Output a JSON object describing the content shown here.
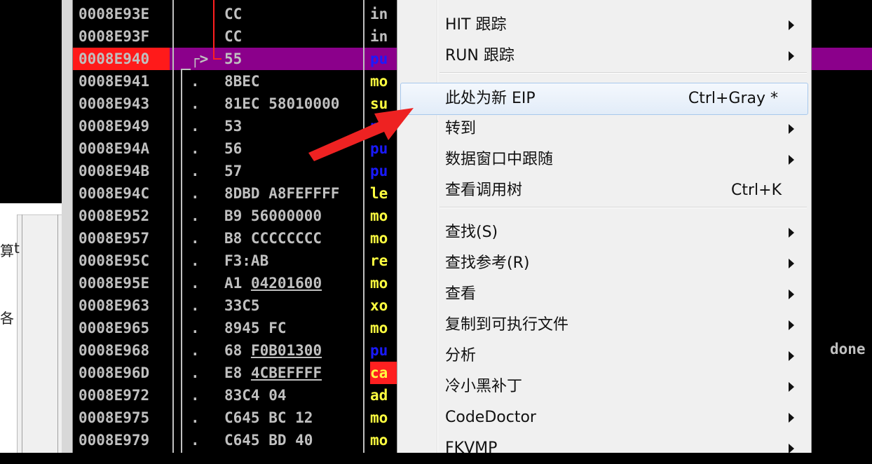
{
  "left_window": {
    "glyph_1": "算",
    "glyph_1b": "t",
    "glyph_2": "各"
  },
  "disassembly": {
    "rows": [
      {
        "addr": "0008E93E",
        "mark": "",
        "hex": "CC",
        "mn": "in",
        "mn_color": "gray"
      },
      {
        "addr": "0008E93F",
        "mark": "",
        "hex": "CC",
        "mn": "in",
        "mn_color": "gray"
      },
      {
        "addr": "0008E940",
        "mark": "┌>",
        "hex": "55",
        "mn": "pu",
        "mn_color": "blue",
        "eip": true
      },
      {
        "addr": "0008E941",
        "mark": ".",
        "hex": "8BEC",
        "mn": "mo",
        "mn_color": "yellow"
      },
      {
        "addr": "0008E943",
        "mark": ".",
        "hex": "81EC 58010000",
        "mn": "su",
        "mn_color": "yellow"
      },
      {
        "addr": "0008E949",
        "mark": ".",
        "hex": "53",
        "mn": "pu",
        "mn_color": "blue"
      },
      {
        "addr": "0008E94A",
        "mark": ".",
        "hex": "56",
        "mn": "pu",
        "mn_color": "blue"
      },
      {
        "addr": "0008E94B",
        "mark": ".",
        "hex": "57",
        "mn": "pu",
        "mn_color": "blue"
      },
      {
        "addr": "0008E94C",
        "mark": ".",
        "hex": "8DBD A8FEFFFF",
        "mn": "le",
        "mn_color": "yellow"
      },
      {
        "addr": "0008E952",
        "mark": ".",
        "hex": "B9 56000000",
        "mn": "mo",
        "mn_color": "yellow"
      },
      {
        "addr": "0008E957",
        "mark": ".",
        "hex": "B8 CCCCCCCC",
        "mn": "mo",
        "mn_color": "yellow"
      },
      {
        "addr": "0008E95C",
        "mark": ".",
        "hex": "F3:AB",
        "mn": "re",
        "mn_color": "yellow"
      },
      {
        "addr": "0008E95E",
        "mark": ".",
        "hex": "A1 ",
        "hex_u": "04201600",
        "mn": "mo",
        "mn_color": "yellow"
      },
      {
        "addr": "0008E963",
        "mark": ".",
        "hex": "33C5",
        "mn": "xo",
        "mn_color": "yellow"
      },
      {
        "addr": "0008E965",
        "mark": ".",
        "hex": "8945 FC",
        "mn": "mo",
        "mn_color": "yellow"
      },
      {
        "addr": "0008E968",
        "mark": ".",
        "hex": "68 ",
        "hex_u": "F0B01300",
        "mn": "pu",
        "mn_color": "blue"
      },
      {
        "addr": "0008E96D",
        "mark": ".",
        "hex": "E8 ",
        "hex_u": "4CBEFFFF",
        "mn": "ca",
        "mn_color": "call"
      },
      {
        "addr": "0008E972",
        "mark": ".",
        "hex": "83C4 04",
        "mn": "ad",
        "mn_color": "yellow"
      },
      {
        "addr": "0008E975",
        "mark": ".",
        "hex": "C645 BC 12",
        "mn": "mo",
        "mn_color": "yellow"
      },
      {
        "addr": "0008E979",
        "mark": ".",
        "hex": "C645 BD 40",
        "mn": "mo",
        "mn_color": "yellow"
      }
    ],
    "right_text": "done"
  },
  "context_menu": {
    "items": [
      {
        "label": "HIT 跟踪",
        "shortcut": "",
        "submenu": true,
        "highlighted": false
      },
      {
        "label": "RUN 跟踪",
        "shortcut": "",
        "submenu": true,
        "highlighted": false
      },
      {
        "label": "此处为新 EIP",
        "shortcut": "Ctrl+Gray *",
        "submenu": false,
        "highlighted": true
      },
      {
        "label": "转到",
        "shortcut": "",
        "submenu": true,
        "highlighted": false
      },
      {
        "label": "数据窗口中跟随",
        "shortcut": "",
        "submenu": true,
        "highlighted": false
      },
      {
        "label": "查看调用树",
        "shortcut": "Ctrl+K",
        "submenu": false,
        "highlighted": false
      },
      {
        "label": "查找(S)",
        "shortcut": "",
        "submenu": true,
        "highlighted": false
      },
      {
        "label": "查找参考(R)",
        "shortcut": "",
        "submenu": true,
        "highlighted": false
      },
      {
        "label": "查看",
        "shortcut": "",
        "submenu": true,
        "highlighted": false
      },
      {
        "label": "复制到可执行文件",
        "shortcut": "",
        "submenu": true,
        "highlighted": false
      },
      {
        "label": "分析",
        "shortcut": "",
        "submenu": true,
        "highlighted": false
      },
      {
        "label": "冷小黑补丁",
        "shortcut": "",
        "submenu": true,
        "highlighted": false
      },
      {
        "label": "CodeDoctor",
        "shortcut": "",
        "submenu": true,
        "highlighted": false
      },
      {
        "label": "FKVMP",
        "shortcut": "",
        "submenu": true,
        "highlighted": false
      }
    ]
  },
  "annotation": {
    "arrow_color": "#ee2222"
  },
  "colors": {
    "eip_row": "#8b008b",
    "eip_addr": "#ff1a1a",
    "jump_line": "#ff2020",
    "menu_highlight_border": "#a8c8ec"
  }
}
